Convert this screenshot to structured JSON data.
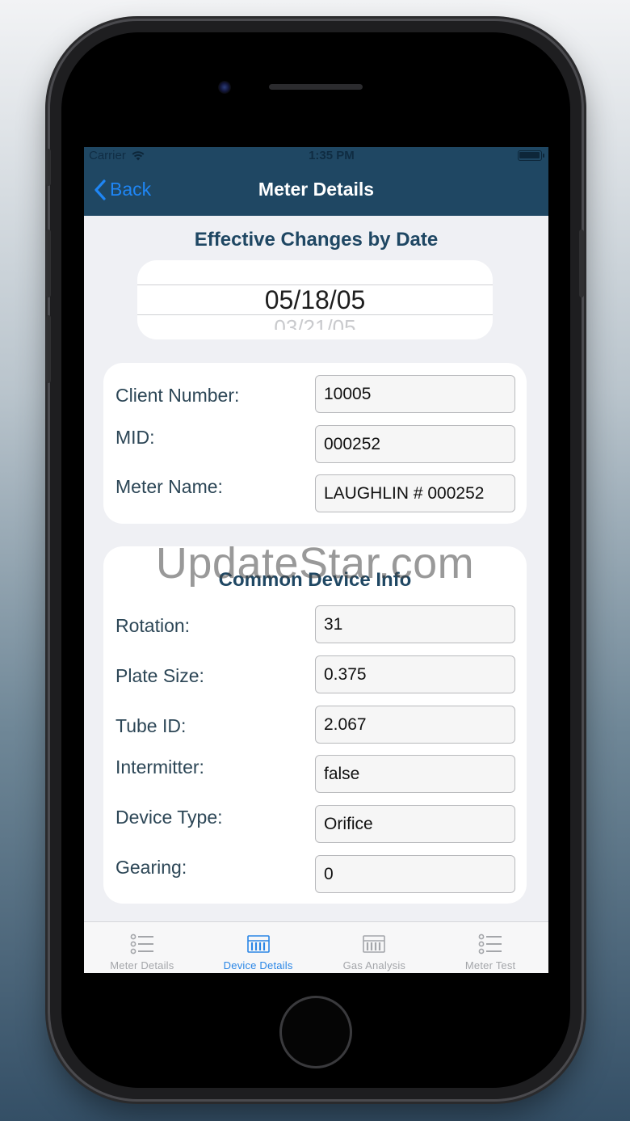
{
  "status_bar": {
    "carrier": "Carrier",
    "time": "1:35 PM"
  },
  "nav": {
    "back_label": "Back",
    "title": "Meter Details"
  },
  "effective_changes": {
    "title": "Effective Changes by Date",
    "selected_date": "05/18/05",
    "next_date": "03/21/05"
  },
  "client_info": [
    {
      "label": "Client Number:",
      "value": "10005"
    },
    {
      "label": "MID:",
      "value": "000252"
    },
    {
      "label": "Meter Name:",
      "value": "LAUGHLIN # 000252"
    }
  ],
  "common_device_info": {
    "title": "Common Device Info",
    "fields": [
      {
        "label": "Rotation:",
        "value": "31"
      },
      {
        "label": "Plate Size:",
        "value": "0.375"
      },
      {
        "label": "Tube ID:",
        "value": "2.067"
      },
      {
        "label": "Intermitter:",
        "value": "false"
      },
      {
        "label": "Device Type:",
        "value": "Orifice"
      },
      {
        "label": "Gearing:",
        "value": "0"
      }
    ]
  },
  "tabs": [
    {
      "label": "Meter Details",
      "icon": "list-icon",
      "active": false
    },
    {
      "label": "Device Details",
      "icon": "gauge-rack-icon",
      "active": true
    },
    {
      "label": "Gas Analysis",
      "icon": "gauge-rack-icon",
      "active": false
    },
    {
      "label": "Meter Test",
      "icon": "list-icon",
      "active": false
    }
  ],
  "watermark": "UpdateStar.com",
  "colors": {
    "nav_bg": "#1f4763",
    "accent_blue": "#1f86f5",
    "title_navy": "#1f4763",
    "tab_active": "#2a86e6",
    "tab_inactive": "#a4a6aa"
  }
}
